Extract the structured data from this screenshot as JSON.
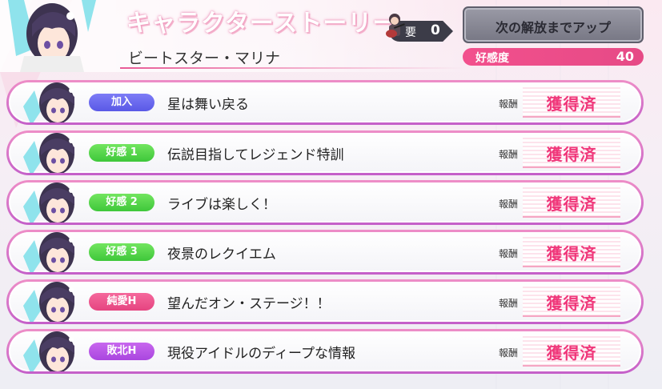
{
  "header": {
    "title": "キャラクターストーリー",
    "character_name": "ビートスター・マリナ",
    "requirement_label": "要",
    "requirement_value": "0",
    "unlock_button_label": "次の解放までアップ",
    "affection_label": "好感度",
    "affection_value": "40"
  },
  "stories": [
    {
      "badge": "加入",
      "badge_color": "#6a69f0",
      "title": "星は舞い戻る",
      "reward_label": "報酬",
      "status": "獲得済"
    },
    {
      "badge": "好感 1",
      "badge_color": "#4fd64a",
      "title": "伝説目指してレジェンド特訓",
      "reward_label": "報酬",
      "status": "獲得済"
    },
    {
      "badge": "好感 2",
      "badge_color": "#4fd64a",
      "title": "ライブは楽しく！",
      "reward_label": "報酬",
      "status": "獲得済"
    },
    {
      "badge": "好感 3",
      "badge_color": "#4fd64a",
      "title": "夜景のレクイエム",
      "reward_label": "報酬",
      "status": "獲得済"
    },
    {
      "badge": "純愛H",
      "badge_color": "#ee5690",
      "title": "望んだオン・ステージ！！",
      "reward_label": "報酬",
      "status": "獲得済"
    },
    {
      "badge": "敗北H",
      "badge_color": "#b957e6",
      "title": "現役アイドルのディープな情報",
      "reward_label": "報酬",
      "status": "獲得済"
    }
  ],
  "colors": {
    "accent": "#e85a96",
    "status_text": "#f0377a"
  },
  "icons": [
    "guitar-character-icon",
    "character-portrait",
    "character-avatar"
  ]
}
